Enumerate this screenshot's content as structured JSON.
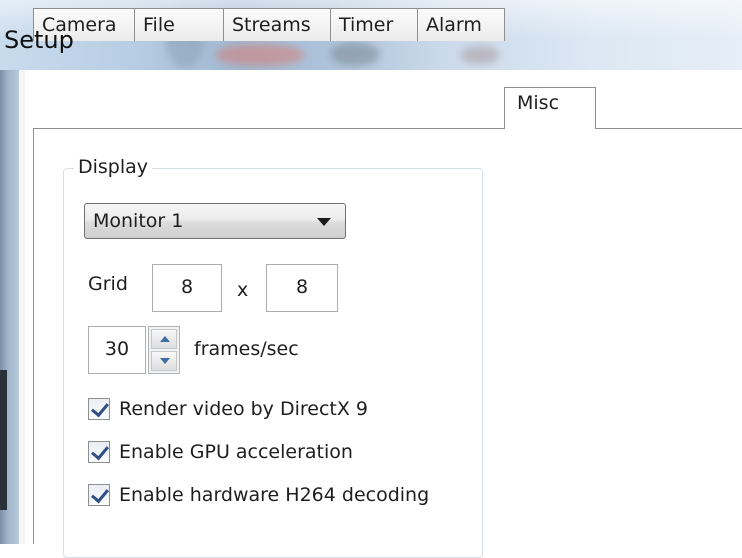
{
  "window": {
    "title": "Setup"
  },
  "tabs": [
    {
      "label": "Camera",
      "active": false
    },
    {
      "label": "File",
      "active": false
    },
    {
      "label": "Streams",
      "active": false
    },
    {
      "label": "Timer",
      "active": false
    },
    {
      "label": "Alarm",
      "active": false
    },
    {
      "label": "Misc",
      "active": true
    }
  ],
  "display": {
    "group_label": "Display",
    "monitor_select": "Monitor 1",
    "grid_label": "Grid",
    "grid_cols": "8",
    "grid_separator": "x",
    "grid_rows": "8",
    "fps_value": "30",
    "fps_unit": "frames/sec",
    "options": [
      {
        "label": "Render video by DirectX 9",
        "checked": true
      },
      {
        "label": "Enable GPU acceleration",
        "checked": true
      },
      {
        "label": "Enable hardware H264 decoding",
        "checked": true
      }
    ]
  }
}
